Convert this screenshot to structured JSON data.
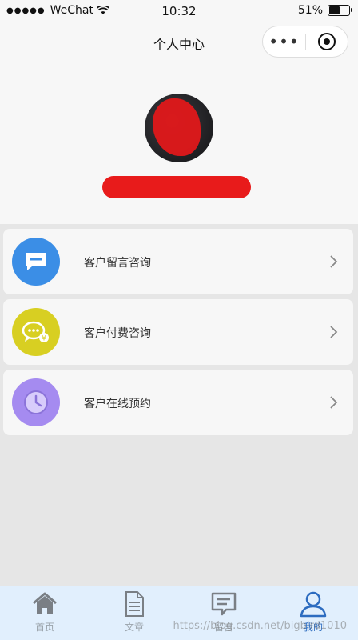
{
  "status_bar": {
    "carrier": "WeChat",
    "time": "10:32",
    "battery": "51%"
  },
  "nav": {
    "title": "个人中心",
    "more_label": "•••"
  },
  "menu": {
    "items": [
      {
        "label": "客户留言咨询",
        "icon": "message-icon",
        "color": "#3b8ee6"
      },
      {
        "label": "客户付费咨询",
        "icon": "chat-pay-icon",
        "color": "#d8cf22"
      },
      {
        "label": "客户在线预约",
        "icon": "clock-icon",
        "color": "#a58bf0"
      }
    ]
  },
  "tabbar": {
    "tabs": [
      {
        "label": "首页",
        "icon": "home-icon",
        "active": false
      },
      {
        "label": "文章",
        "icon": "document-icon",
        "active": false
      },
      {
        "label": "留言",
        "icon": "comment-icon",
        "active": false
      },
      {
        "label": "我的",
        "icon": "user-icon",
        "active": true
      }
    ],
    "active_color": "#2d6cc0"
  },
  "watermark": "https://blog.csdn.net/bigbird1010"
}
